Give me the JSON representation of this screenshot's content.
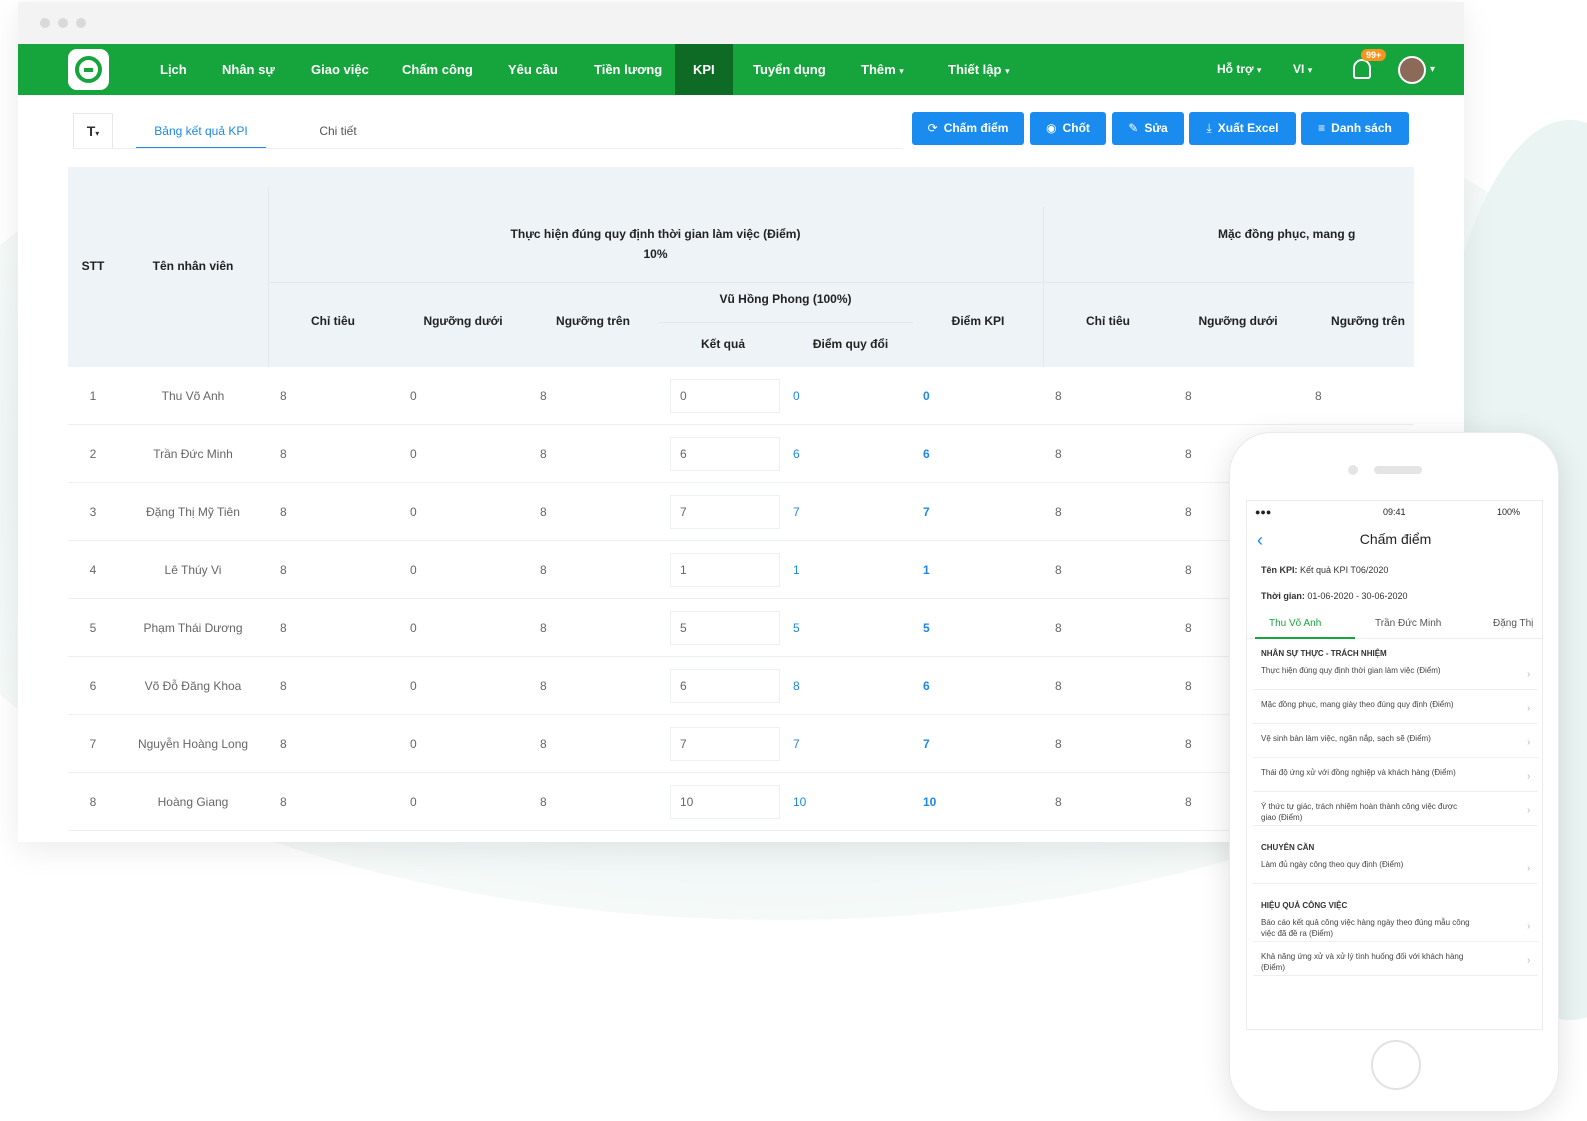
{
  "nav": {
    "items": [
      "Lịch",
      "Nhân sự",
      "Giao việc",
      "Chấm công",
      "Yêu cầu",
      "Tiền lương",
      "KPI",
      "Tuyển dụng",
      "Thêm",
      "Thiết lập"
    ],
    "active": "KPI",
    "help": "Hỗ trợ",
    "lang": "VI",
    "badge": "99+"
  },
  "toolbar": {
    "filter_label": "T",
    "tabs": [
      "Bảng kết quả KPI",
      "Chi tiết"
    ],
    "buttons": [
      "Chấm điểm",
      "Chốt",
      "Sửa",
      "Xuất Excel",
      "Danh sách"
    ]
  },
  "table": {
    "headers": {
      "stt": "STT",
      "name": "Tên nhân viên",
      "group1": "Thực hiện đúng quy định thời gian làm việc (Điểm)",
      "group1_weight": "10%",
      "group2": "Mặc đồng phục, mang g",
      "chi_tieu": "Chỉ tiêu",
      "nguong_duoi": "Ngưỡng dưới",
      "nguong_tren": "Ngưỡng trên",
      "reviewer": "Vũ Hồng Phong (100%)",
      "ket_qua": "Kết quả",
      "diem_quy_doi": "Điểm quy đổi",
      "diem_kpi": "Điểm KPI"
    },
    "rows": [
      {
        "stt": "1",
        "name": "Thu Võ Anh",
        "chi_tieu": "8",
        "nguong_duoi": "0",
        "nguong_tren": "8",
        "ket_qua": "0",
        "quy_doi": "0",
        "kpi": "0",
        "c2": "8",
        "d2": "8",
        "t2": "8"
      },
      {
        "stt": "2",
        "name": "Trần Đức Minh",
        "chi_tieu": "8",
        "nguong_duoi": "0",
        "nguong_tren": "8",
        "ket_qua": "6",
        "quy_doi": "6",
        "kpi": "6",
        "c2": "8",
        "d2": "8",
        "t2": ""
      },
      {
        "stt": "3",
        "name": "Đặng Thị Mỹ Tiên",
        "chi_tieu": "8",
        "nguong_duoi": "0",
        "nguong_tren": "8",
        "ket_qua": "7",
        "quy_doi": "7",
        "kpi": "7",
        "c2": "8",
        "d2": "8",
        "t2": ""
      },
      {
        "stt": "4",
        "name": "Lê Thúy Vi",
        "chi_tieu": "8",
        "nguong_duoi": "0",
        "nguong_tren": "8",
        "ket_qua": "1",
        "quy_doi": "1",
        "kpi": "1",
        "c2": "8",
        "d2": "8",
        "t2": ""
      },
      {
        "stt": "5",
        "name": "Phạm Thái Dương",
        "chi_tieu": "8",
        "nguong_duoi": "0",
        "nguong_tren": "8",
        "ket_qua": "5",
        "quy_doi": "5",
        "kpi": "5",
        "c2": "8",
        "d2": "8",
        "t2": ""
      },
      {
        "stt": "6",
        "name": "Võ Đỗ Đăng Khoa",
        "chi_tieu": "8",
        "nguong_duoi": "0",
        "nguong_tren": "8",
        "ket_qua": "6",
        "quy_doi": "8",
        "kpi": "6",
        "c2": "8",
        "d2": "8",
        "t2": ""
      },
      {
        "stt": "7",
        "name": "Nguyễn Hoàng Long",
        "chi_tieu": "8",
        "nguong_duoi": "0",
        "nguong_tren": "8",
        "ket_qua": "7",
        "quy_doi": "7",
        "kpi": "7",
        "c2": "8",
        "d2": "8",
        "t2": ""
      },
      {
        "stt": "8",
        "name": "Hoàng Giang",
        "chi_tieu": "8",
        "nguong_duoi": "0",
        "nguong_tren": "8",
        "ket_qua": "10",
        "quy_doi": "10",
        "kpi": "10",
        "c2": "8",
        "d2": "8",
        "t2": ""
      }
    ]
  },
  "phone": {
    "time": "09:41",
    "battery": "100%",
    "signal": "●●●",
    "title": "Chấm điểm",
    "kpi_label": "Tên KPI:",
    "kpi_value": "Kết quả KPI T06/2020",
    "time_label": "Thời gian:",
    "time_value": "01-06-2020 - 30-06-2020",
    "tabs": [
      "Thu Võ Anh",
      "Trần Đức Minh",
      "Đặng Thị"
    ],
    "sections": [
      {
        "title": "NHÂN SỰ THỰC - TRÁCH NHIỆM",
        "items": [
          "Thực hiện đúng quy định thời gian làm việc (Điểm)",
          "Mặc đồng phục, mang giày theo đúng quy định (Điểm)",
          "Vệ sinh bàn làm việc, ngăn nắp, sạch sẽ (Điểm)",
          "Thái độ ứng xử với đồng nghiệp và khách hàng (Điểm)",
          "Ý thức tự giác, trách nhiệm hoàn thành công việc được giao (Điểm)"
        ]
      },
      {
        "title": "CHUYÊN CẦN",
        "items": [
          "Làm đủ ngày công theo quy định (Điểm)"
        ]
      },
      {
        "title": "HIỆU QUẢ CÔNG VIỆC",
        "items": [
          "Báo cáo kết quả công việc hàng ngày theo đúng mẫu công việc đã đề ra (Điểm)",
          "Khả năng ứng xử và xử lý tình huống đối với khách hàng (Điểm)"
        ]
      }
    ]
  },
  "colors": {
    "nav_green": "#16a53d",
    "nav_active": "#0d6b25",
    "button_blue": "#1a8cf0",
    "link_blue": "#1e88e5",
    "header_bg": "#eef3f7"
  }
}
